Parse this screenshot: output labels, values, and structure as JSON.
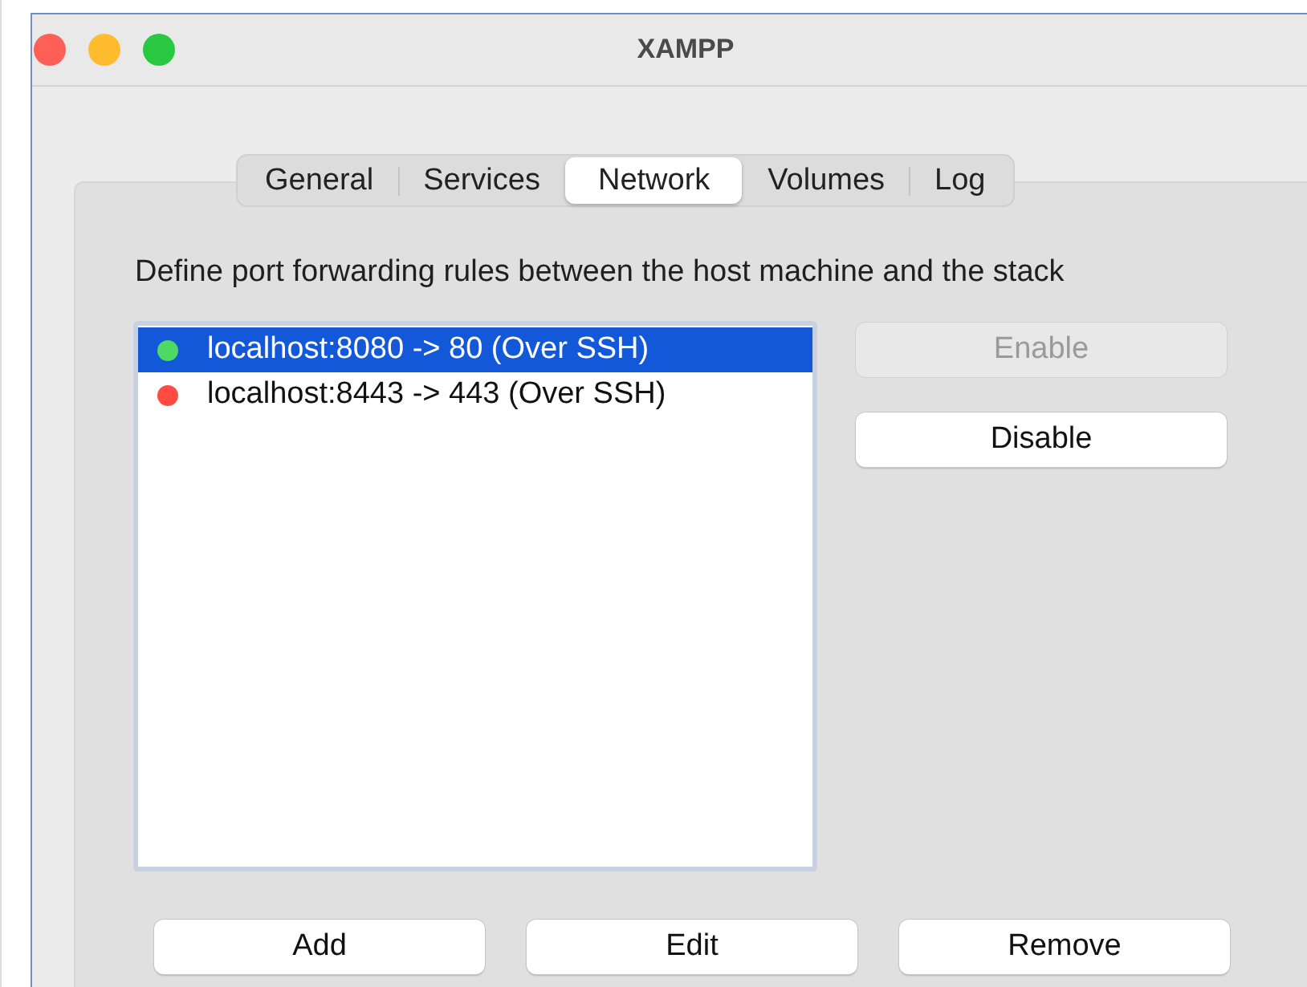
{
  "window": {
    "title": "XAMPP"
  },
  "tabs": [
    {
      "label": "General",
      "selected": false
    },
    {
      "label": "Services",
      "selected": false
    },
    {
      "label": "Network",
      "selected": true
    },
    {
      "label": "Volumes",
      "selected": false
    },
    {
      "label": "Log",
      "selected": false
    }
  ],
  "description": "Define port forwarding rules between the host machine and the stack",
  "rules": [
    {
      "label": "localhost:8080 -> 80 (Over SSH)",
      "color": "#4cd964",
      "selected": true
    },
    {
      "label": "localhost:8443 -> 443 (Over SSH)",
      "color": "#ff4b41",
      "selected": false
    }
  ],
  "side_buttons": [
    {
      "label": "Enable",
      "disabled": true
    },
    {
      "label": "Disable",
      "disabled": false
    }
  ],
  "bottom_buttons": [
    {
      "label": "Add"
    },
    {
      "label": "Edit"
    },
    {
      "label": "Remove"
    }
  ]
}
